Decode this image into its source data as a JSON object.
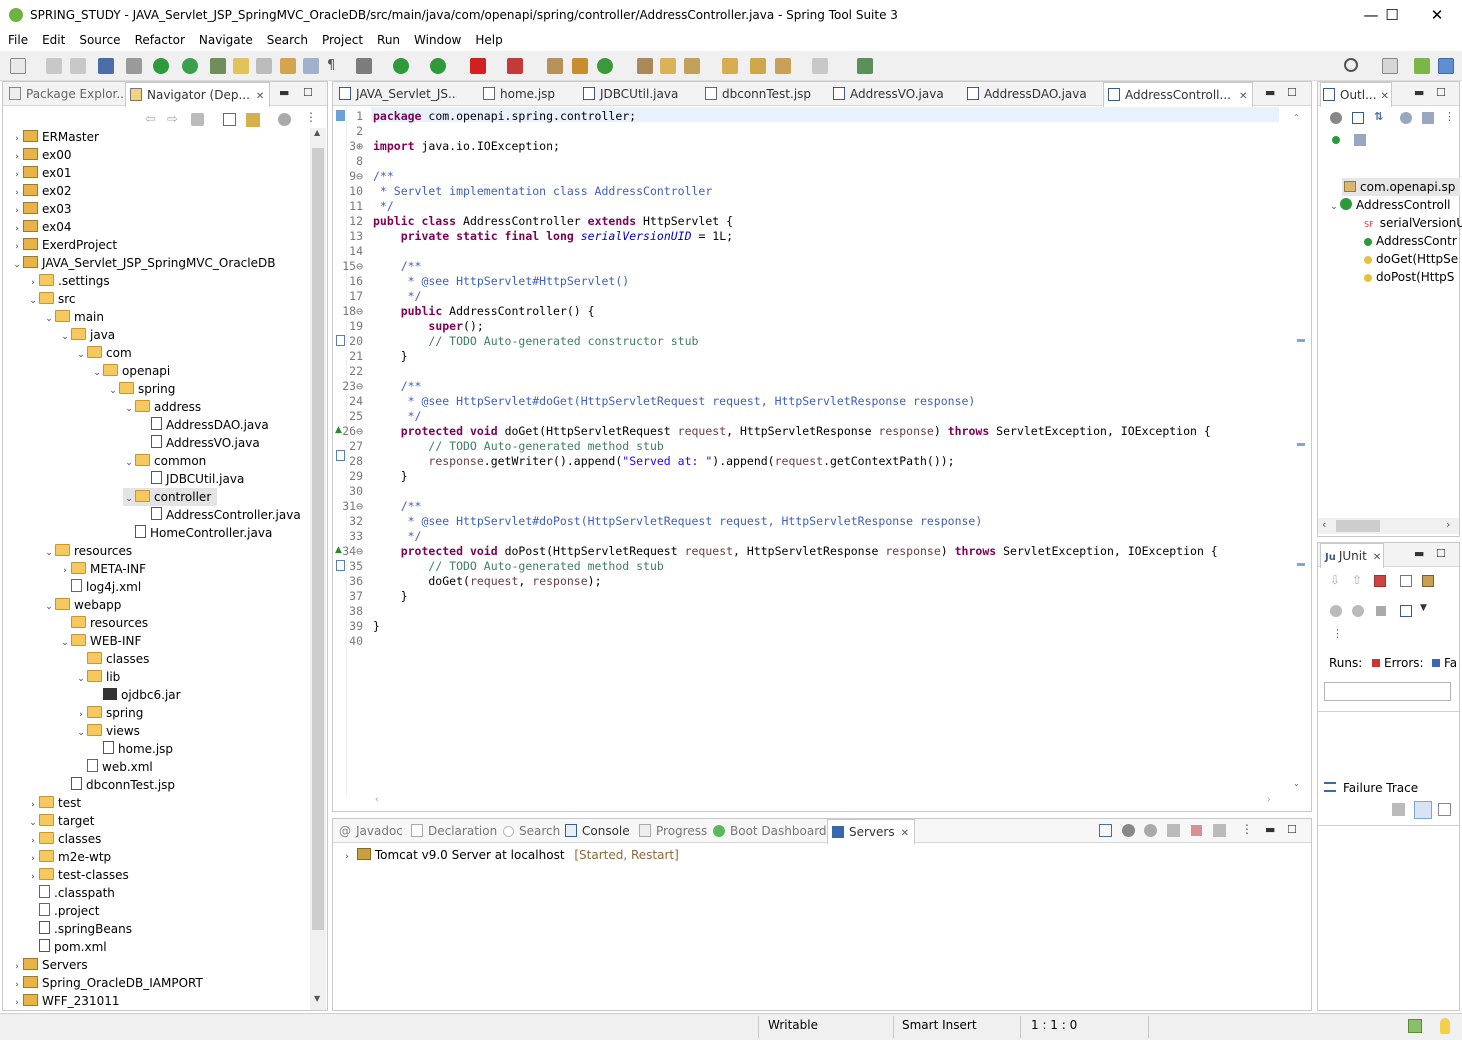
{
  "window": {
    "title": "SPRING_STUDY - JAVA_Servlet_JSP_SpringMVC_OracleDB/src/main/java/com/openapi/spring/controller/AddressController.java - Spring Tool Suite 3",
    "minimize": "—",
    "maximize": "☐",
    "close": "✕"
  },
  "menu": [
    "File",
    "Edit",
    "Source",
    "Refactor",
    "Navigate",
    "Search",
    "Project",
    "Run",
    "Window",
    "Help"
  ],
  "left_panel": {
    "tabs": [
      "Package Explor...",
      "Navigator (Dep..."
    ],
    "tree": [
      {
        "label": "ERMaster",
        "depth": 0,
        "kind": "proj",
        "tw": "›"
      },
      {
        "label": "ex00",
        "depth": 0,
        "kind": "proj",
        "tw": "›"
      },
      {
        "label": "ex01",
        "depth": 0,
        "kind": "proj",
        "tw": "›"
      },
      {
        "label": "ex02",
        "depth": 0,
        "kind": "proj",
        "tw": "›"
      },
      {
        "label": "ex03",
        "depth": 0,
        "kind": "proj",
        "tw": "›"
      },
      {
        "label": "ex04",
        "depth": 0,
        "kind": "proj",
        "tw": "›"
      },
      {
        "label": "ExerdProject",
        "depth": 0,
        "kind": "proj",
        "tw": "›"
      },
      {
        "label": "JAVA_Servlet_JSP_SpringMVC_OracleDB",
        "depth": 0,
        "kind": "proj",
        "tw": "⌄"
      },
      {
        "label": ".settings",
        "depth": 1,
        "kind": "folder",
        "tw": "›"
      },
      {
        "label": "src",
        "depth": 1,
        "kind": "folder",
        "tw": "⌄"
      },
      {
        "label": "main",
        "depth": 2,
        "kind": "folder",
        "tw": "⌄"
      },
      {
        "label": "java",
        "depth": 3,
        "kind": "folder",
        "tw": "⌄"
      },
      {
        "label": "com",
        "depth": 4,
        "kind": "folder",
        "tw": "⌄"
      },
      {
        "label": "openapi",
        "depth": 5,
        "kind": "folder",
        "tw": "⌄"
      },
      {
        "label": "spring",
        "depth": 6,
        "kind": "folder",
        "tw": "⌄"
      },
      {
        "label": "address",
        "depth": 7,
        "kind": "folder",
        "tw": "⌄"
      },
      {
        "label": "AddressDAO.java",
        "depth": 8,
        "kind": "file",
        "tw": ""
      },
      {
        "label": "AddressVO.java",
        "depth": 8,
        "kind": "file",
        "tw": ""
      },
      {
        "label": "common",
        "depth": 7,
        "kind": "folder",
        "tw": "⌄"
      },
      {
        "label": "JDBCUtil.java",
        "depth": 8,
        "kind": "file",
        "tw": ""
      },
      {
        "label": "controller",
        "depth": 7,
        "kind": "folder",
        "tw": "⌄",
        "selected": true
      },
      {
        "label": "AddressController.java",
        "depth": 8,
        "kind": "file",
        "tw": ""
      },
      {
        "label": "HomeController.java",
        "depth": 7,
        "kind": "file",
        "tw": ""
      },
      {
        "label": "resources",
        "depth": 2,
        "kind": "folder",
        "tw": "⌄"
      },
      {
        "label": "META-INF",
        "depth": 3,
        "kind": "folder",
        "tw": "›"
      },
      {
        "label": "log4j.xml",
        "depth": 3,
        "kind": "xml",
        "tw": ""
      },
      {
        "label": "webapp",
        "depth": 2,
        "kind": "folder",
        "tw": "⌄"
      },
      {
        "label": "resources",
        "depth": 3,
        "kind": "folder",
        "tw": ""
      },
      {
        "label": "WEB-INF",
        "depth": 3,
        "kind": "folder",
        "tw": "⌄"
      },
      {
        "label": "classes",
        "depth": 4,
        "kind": "folder",
        "tw": ""
      },
      {
        "label": "lib",
        "depth": 4,
        "kind": "folder",
        "tw": "⌄"
      },
      {
        "label": "ojdbc6.jar",
        "depth": 5,
        "kind": "jar",
        "tw": ""
      },
      {
        "label": "spring",
        "depth": 4,
        "kind": "folder",
        "tw": "›"
      },
      {
        "label": "views",
        "depth": 4,
        "kind": "folder",
        "tw": "⌄"
      },
      {
        "label": "home.jsp",
        "depth": 5,
        "kind": "file",
        "tw": ""
      },
      {
        "label": "web.xml",
        "depth": 4,
        "kind": "xml",
        "tw": ""
      },
      {
        "label": "dbconnTest.jsp",
        "depth": 3,
        "kind": "file",
        "tw": ""
      },
      {
        "label": "test",
        "depth": 1,
        "kind": "folder",
        "tw": "›"
      },
      {
        "label": "target",
        "depth": 0,
        "kind": "folder",
        "tw": "⌄",
        "offset": 1
      },
      {
        "label": "classes",
        "depth": 1,
        "kind": "folder",
        "tw": "›"
      },
      {
        "label": "m2e-wtp",
        "depth": 1,
        "kind": "folder",
        "tw": "›"
      },
      {
        "label": "test-classes",
        "depth": 1,
        "kind": "folder",
        "tw": "›"
      },
      {
        "label": ".classpath",
        "depth": 1,
        "kind": "xml",
        "tw": ""
      },
      {
        "label": ".project",
        "depth": 1,
        "kind": "xml",
        "tw": ""
      },
      {
        "label": ".springBeans",
        "depth": 1,
        "kind": "file",
        "tw": ""
      },
      {
        "label": "pom.xml",
        "depth": 1,
        "kind": "file",
        "tw": ""
      },
      {
        "label": "Servers",
        "depth": 0,
        "kind": "proj",
        "tw": "›"
      },
      {
        "label": "Spring_OracleDB_IAMPORT",
        "depth": 0,
        "kind": "proj",
        "tw": "›"
      },
      {
        "label": "WFF_231011",
        "depth": 0,
        "kind": "proj",
        "tw": "›"
      }
    ]
  },
  "editor": {
    "tabs": [
      "JAVA_Servlet_JS...",
      "home.jsp",
      "JDBCUtil.java",
      "dbconnTest.jsp",
      "AddressVO.java",
      "AddressDAO.java",
      "AddressControll..."
    ],
    "lines": [
      {
        "n": "1",
        "html": "<span class=\"kw\">package</span> com.openapi.spring.controller;"
      },
      {
        "n": "2",
        "html": ""
      },
      {
        "n": "3⊕",
        "html": "<span class=\"kw\">import</span> java.io.IOException;"
      },
      {
        "n": "8",
        "html": ""
      },
      {
        "n": "9⊖",
        "html": "<span class=\"cm\">/**</span>"
      },
      {
        "n": "10",
        "html": "<span class=\"cm\"> * Servlet implementation class AddressController</span>"
      },
      {
        "n": "11",
        "html": "<span class=\"cm\"> */</span>"
      },
      {
        "n": "12",
        "html": "<span class=\"kw\">public class</span> AddressController <span class=\"kw\">extends</span> HttpServlet {"
      },
      {
        "n": "13",
        "html": "    <span class=\"kw\">private static final long</span> <span class=\"fld\">serialVersionUID</span> = 1L;"
      },
      {
        "n": "14",
        "html": ""
      },
      {
        "n": "15⊖",
        "html": "    <span class=\"cm\">/**</span>"
      },
      {
        "n": "16",
        "html": "<span class=\"cm\">     * @see HttpServlet#HttpServlet()</span>"
      },
      {
        "n": "17",
        "html": "<span class=\"cm\">     */</span>"
      },
      {
        "n": "18⊖",
        "html": "    <span class=\"kw\">public</span> AddressController() {"
      },
      {
        "n": "19",
        "html": "        <span class=\"kw\">super</span>();"
      },
      {
        "n": "20",
        "html": "        <span class=\"lc\">// TODO Auto-generated constructor stub</span>"
      },
      {
        "n": "21",
        "html": "    }"
      },
      {
        "n": "22",
        "html": ""
      },
      {
        "n": "23⊖",
        "html": "    <span class=\"cm\">/**</span>"
      },
      {
        "n": "24",
        "html": "<span class=\"cm\">     * @see HttpServlet#doGet(HttpServletRequest request, HttpServletResponse response)</span>"
      },
      {
        "n": "25",
        "html": "<span class=\"cm\">     */</span>"
      },
      {
        "n": "26⊖",
        "html": "    <span class=\"kw\">protected void</span> doGet(HttpServletRequest <span class=\"par\">request</span>, HttpServletResponse <span class=\"par\">response</span>) <span class=\"kw\">throws</span> ServletException, IOException {"
      },
      {
        "n": "27",
        "html": "        <span class=\"lc\">// TODO Auto-generated method stub</span>"
      },
      {
        "n": "28",
        "html": "        <span class=\"par\">response</span>.getWriter().append(<span class=\"str\">\"Served at: \"</span>).append(<span class=\"par\">request</span>.getContextPath());"
      },
      {
        "n": "29",
        "html": "    }"
      },
      {
        "n": "30",
        "html": ""
      },
      {
        "n": "31⊖",
        "html": "    <span class=\"cm\">/**</span>"
      },
      {
        "n": "32",
        "html": "<span class=\"cm\">     * @see HttpServlet#doPost(HttpServletRequest request, HttpServletResponse response)</span>"
      },
      {
        "n": "33",
        "html": "<span class=\"cm\">     */</span>"
      },
      {
        "n": "34⊖",
        "html": "    <span class=\"kw\">protected void</span> doPost(HttpServletRequest <span class=\"par\">request</span>, HttpServletResponse <span class=\"par\">response</span>) <span class=\"kw\">throws</span> ServletException, IOException {"
      },
      {
        "n": "35",
        "html": "        <span class=\"lc\">// TODO Auto-generated method stub</span>"
      },
      {
        "n": "36",
        "html": "        doGet(<span class=\"par\">request</span>, <span class=\"par\">response</span>);"
      },
      {
        "n": "37",
        "html": "    }"
      },
      {
        "n": "38",
        "html": ""
      },
      {
        "n": "39",
        "html": "}"
      },
      {
        "n": "40",
        "html": ""
      }
    ]
  },
  "bottom_panel": {
    "tabs": [
      "Javadoc",
      "Declaration",
      "Search",
      "Console",
      "Progress",
      "Boot Dashboard",
      "Servers"
    ],
    "server_name": "Tomcat v9.0 Server at localhost",
    "server_state": "[Started, Restart]"
  },
  "outline": {
    "tab": "Outl...",
    "items": [
      "com.openapi.sp",
      "AddressControll",
      "serialVersionU",
      "AddressContr",
      "doGet(HttpSe",
      "doPost(HttpS"
    ]
  },
  "junit": {
    "tab": "JUnit",
    "runs_label": "Runs:",
    "errors_label": "Errors:",
    "failures_label": "Fa",
    "failure_trace": "Failure Trace"
  },
  "status": {
    "writable": "Writable",
    "insert_mode": "Smart Insert",
    "position": "1 : 1 : 0"
  },
  "colors": {
    "keyword": "#7f0055",
    "javadoc": "#3f5fbf",
    "comment": "#3f7f5f",
    "string": "#2a00ff"
  }
}
